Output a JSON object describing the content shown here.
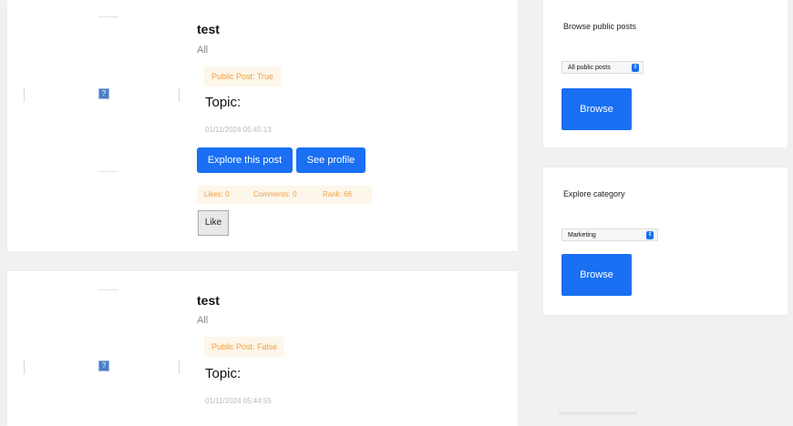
{
  "posts": [
    {
      "title": "test",
      "category": "All",
      "public_label": "Public Post: True",
      "topic_label": "Topic:",
      "date": "01/11/2024 05:45:13",
      "explore_label": "Explore this post",
      "profile_label": "See profile",
      "likes": "Likes: 0",
      "comments": "Comments: 0",
      "rank": "Rank: 66",
      "like_label": "Like"
    },
    {
      "title": "test",
      "category": "All",
      "public_label": "Public Post: False",
      "topic_label": "Topic:",
      "date": "01/11/2024 05:44:55"
    }
  ],
  "browse_panel": {
    "title": "Browse public posts",
    "selected": "All public posts",
    "button_label": "Browse"
  },
  "category_panel": {
    "title": "Explore category",
    "selected": "Marketing",
    "button_label": "Browse"
  },
  "colors": {
    "primary": "#1a6ff2",
    "tag_bg": "#fdf6ea",
    "tag_text": "#f0a040",
    "page_bg": "#f1f1f1"
  },
  "icons": {
    "broken_image": "broken-image-icon",
    "select_chevron": "chevron-updown-icon"
  }
}
